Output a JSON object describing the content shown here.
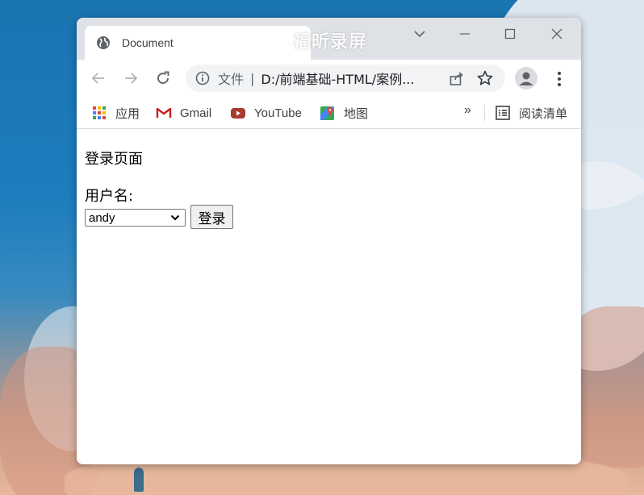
{
  "browser": {
    "tab_title": "Document",
    "address": {
      "scheme_label": "文件",
      "separator": "|",
      "url": "D:/前端基础-HTML/案例..."
    },
    "bookmarks": [
      {
        "label": "应用",
        "icon": "apps-grid-icon"
      },
      {
        "label": "Gmail",
        "icon": "gmail-icon"
      },
      {
        "label": "YouTube",
        "icon": "youtube-icon"
      },
      {
        "label": "地图",
        "icon": "maps-icon"
      }
    ],
    "bookmarks_overflow": "»",
    "reading_list": "阅读清单"
  },
  "watermark": "福昕录屏",
  "page": {
    "heading": "登录页面",
    "username_label": "用户名:",
    "username_select": {
      "selected": "andy"
    },
    "login_button": "登录"
  },
  "colors": {
    "titlebar": "#dee1e6",
    "omnibox": "#f1f3f4",
    "icon_gray": "#5f6368",
    "desktop_blue": "#1a74b0"
  }
}
